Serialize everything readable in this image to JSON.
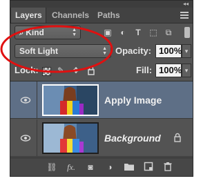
{
  "tabs": [
    {
      "label": "Layers",
      "active": true
    },
    {
      "label": "Channels",
      "active": false
    },
    {
      "label": "Paths",
      "active": false
    }
  ],
  "filter": {
    "label": "Kind"
  },
  "blend_mode": {
    "value": "Soft Light"
  },
  "opacity": {
    "label": "Opacity:",
    "value": "100%"
  },
  "lock": {
    "label": "Lock:"
  },
  "fill": {
    "label": "Fill:",
    "value": "100%"
  },
  "layers": [
    {
      "name": "Apply Image",
      "selected": true,
      "visible": true,
      "locked": false
    },
    {
      "name": "Background",
      "selected": false,
      "visible": true,
      "locked": true
    }
  ],
  "bottom_icons": [
    "link-icon",
    "fx-icon",
    "mask-icon",
    "adjustment-icon",
    "group-folder-icon",
    "new-layer-icon",
    "trash-icon"
  ],
  "filter_icons": [
    "image-filter-icon",
    "adjustment-filter-icon",
    "type-filter-icon",
    "shape-filter-icon",
    "smart-object-filter-icon"
  ],
  "colors": {
    "panel": "#535353",
    "selected_row": "#5e6f86",
    "annotation": "#e01010"
  }
}
